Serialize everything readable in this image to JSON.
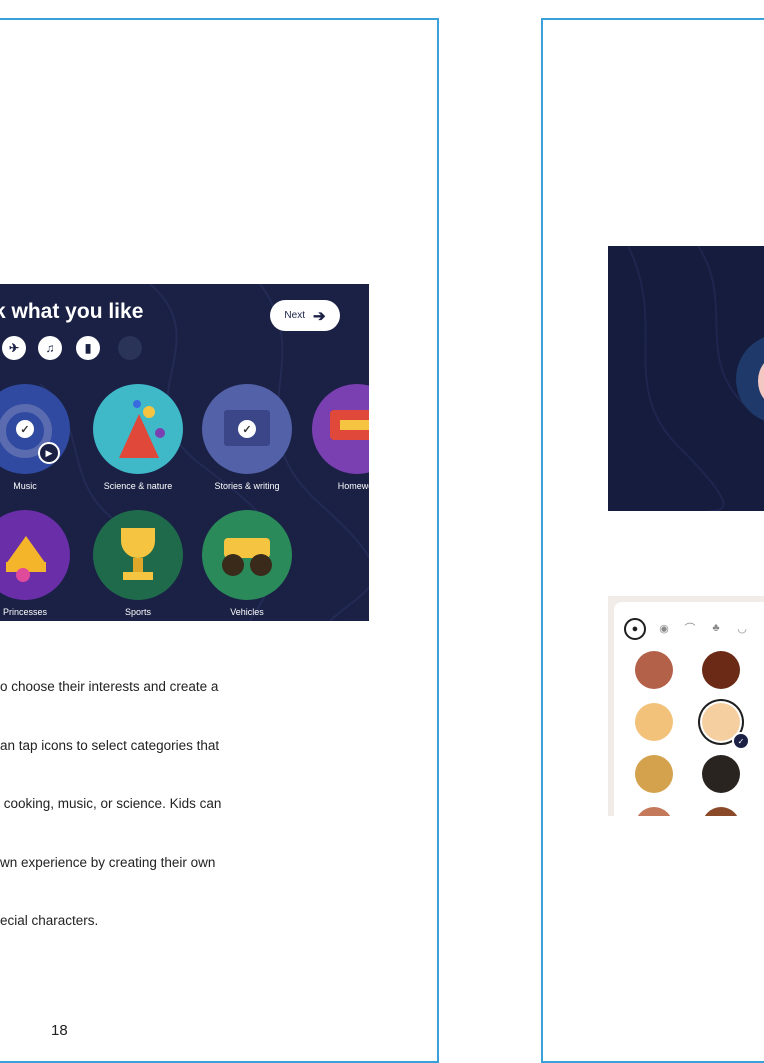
{
  "left_page": {
    "screenshot": {
      "heading": "k what you like",
      "next_button": "Next",
      "filter_icons": [
        "airplane-icon",
        "music-note-icon",
        "book-icon"
      ],
      "categories": [
        {
          "label": "Music",
          "icon": "headphones-icon",
          "selected": true,
          "color": "#2f4aa0"
        },
        {
          "label": "Science & nature",
          "icon": "flask-icon",
          "selected": false,
          "color": "#3fb8c8"
        },
        {
          "label": "Stories & writing",
          "icon": "notebook-icon",
          "selected": true,
          "color": "#5361a8"
        },
        {
          "label": "Homewor",
          "icon": "backpack-icon",
          "selected": false,
          "color": "#7a3fb0"
        },
        {
          "label": "Princesses",
          "icon": "crown-icon",
          "selected": false,
          "color": "#6a2ea8"
        },
        {
          "label": "Sports",
          "icon": "trophy-icon",
          "selected": false,
          "color": "#1f6a4a"
        },
        {
          "label": "Vehicles",
          "icon": "monster-truck-icon",
          "selected": false,
          "color": "#2a8a5a"
        }
      ]
    },
    "caption_lines": [
      "o choose their interests and create a",
      "an tap icons to select categories that",
      " cooking, music, or science. Kids can",
      "wn experience by creating their own",
      "ecial characters."
    ],
    "page_number": "18"
  },
  "right_page": {
    "avatar_colors": {
      "ring": "#1f3a6a",
      "face": "#f3c7c2"
    },
    "tool_icons": [
      "face-icon",
      "eye-icon",
      "eyebrow-icon",
      "nose-icon",
      "mouth-icon"
    ],
    "skin_swatches": [
      "#b4614a",
      "#6a2a16",
      "#f3c27a",
      "#f6cfa0",
      "#d4a24c",
      "#2a2420"
    ],
    "selected_swatch": 3
  },
  "colors": {
    "frame_border": "#3aa0d8",
    "screenshot_bg": "#1a2145"
  }
}
